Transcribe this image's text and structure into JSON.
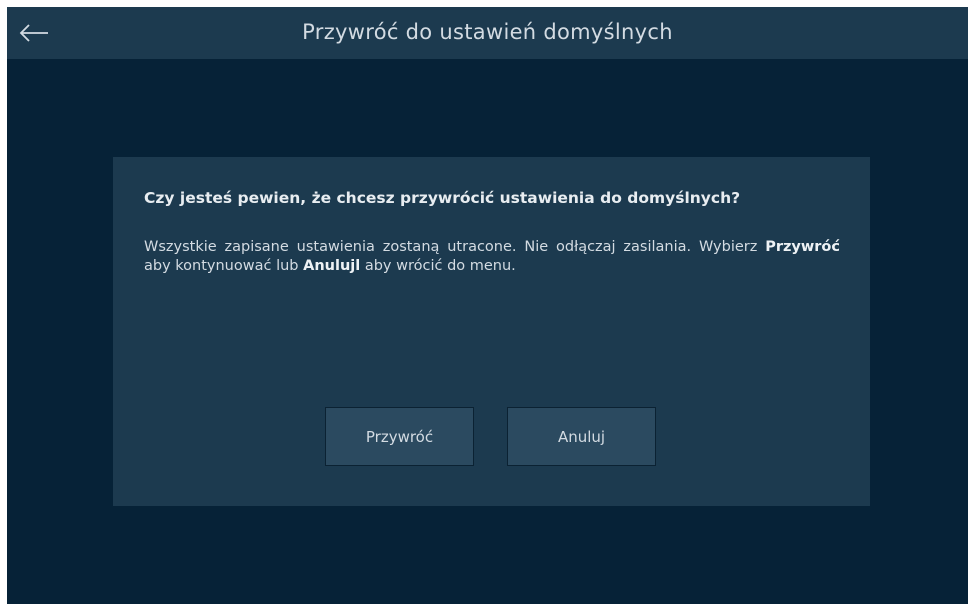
{
  "header": {
    "back_icon": "arrow-left-icon",
    "title": "Przywróć do ustawień domyślnych"
  },
  "dialog": {
    "question": "Czy jesteś pewien, że chcesz przywrócić ustawienia do domyślnych?",
    "message": {
      "part1": "Wszystkie zapisane ustawienia zostaną utracone. Nie odłączaj zasilania. Wybierz ",
      "restore_word": "Przywróć",
      "part2": " aby kontynuować lub ",
      "cancel_word": "Anulujl",
      "part3": " aby wrócić do menu."
    },
    "buttons": {
      "restore_label": "Przywróć",
      "cancel_label": "Anuluj"
    }
  },
  "colors": {
    "background": "#062237",
    "header": "#1c3a4f",
    "dialog": "#1c3a4f",
    "button": "#2b4a60",
    "text": "#d3dbe2"
  }
}
